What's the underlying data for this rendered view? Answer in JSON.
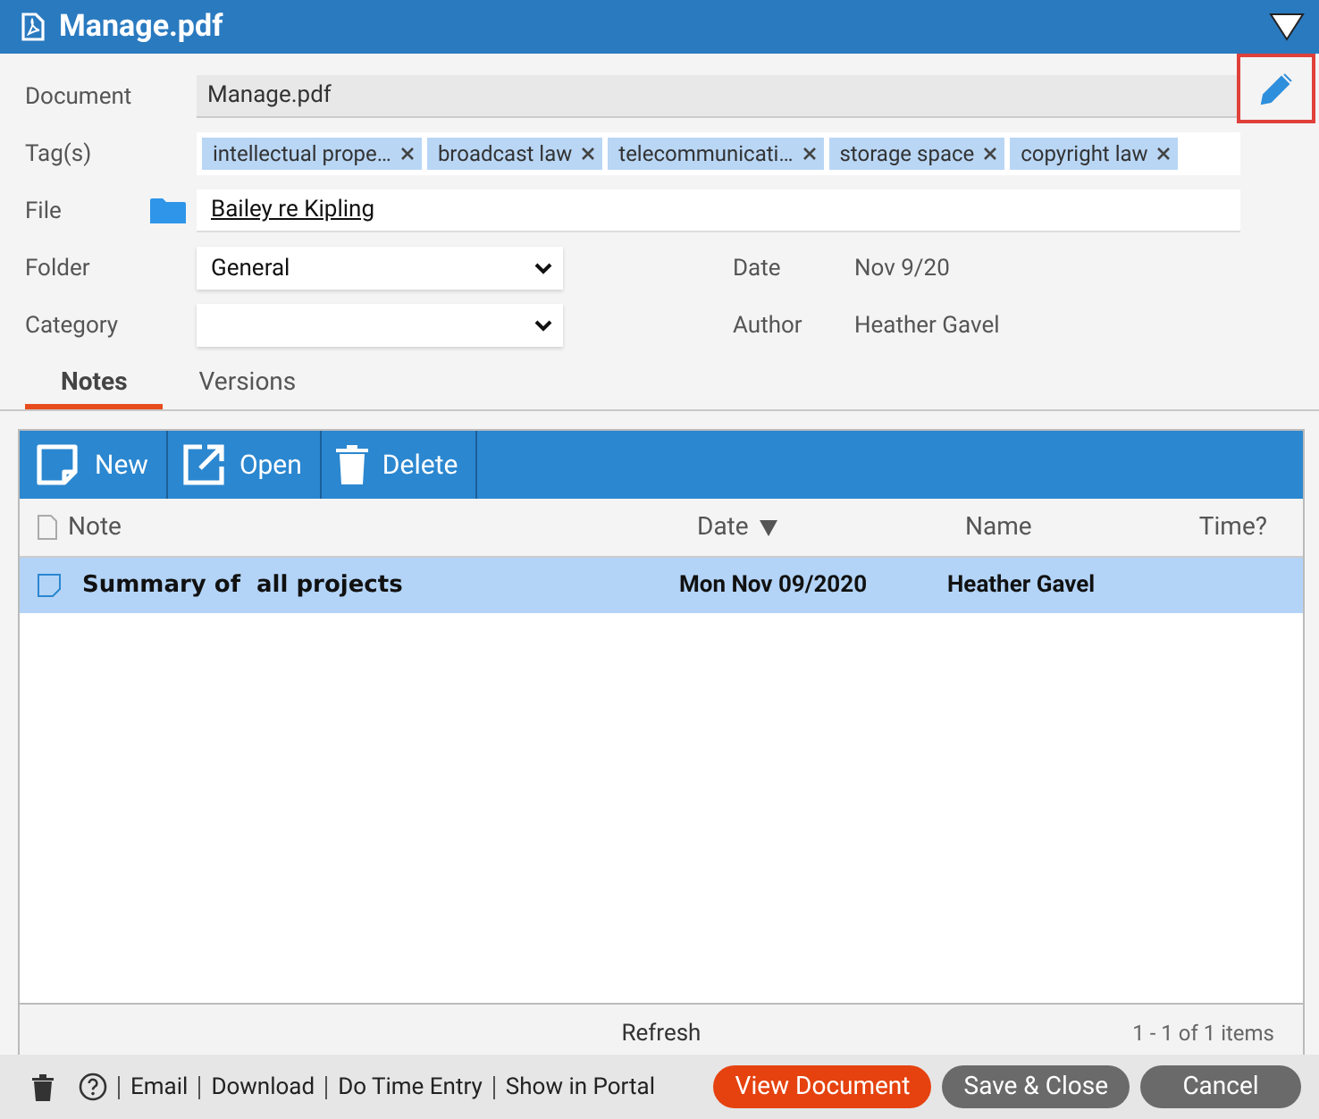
{
  "title": "Manage.pdf",
  "document": {
    "label": "Document",
    "value": "Manage.pdf"
  },
  "tags": {
    "label": "Tag(s)",
    "items": [
      {
        "label": "intellectual prope…"
      },
      {
        "label": "broadcast law"
      },
      {
        "label": "telecommunicati…"
      },
      {
        "label": "storage space"
      },
      {
        "label": "copyright law"
      }
    ]
  },
  "file": {
    "label": "File",
    "value": "Bailey re Kipling"
  },
  "folder": {
    "label": "Folder",
    "value": "General"
  },
  "category": {
    "label": "Category"
  },
  "date": {
    "label": "Date",
    "value": "Nov 9/20"
  },
  "author": {
    "label": "Author",
    "value": "Heather Gavel"
  },
  "tabs": [
    {
      "label": "Notes",
      "selected": true
    },
    {
      "label": "Versions",
      "selected": false
    }
  ],
  "toolbar": [
    {
      "label": "New",
      "kind": "new"
    },
    {
      "label": "Open",
      "kind": "open"
    },
    {
      "label": "Delete",
      "kind": "delete"
    }
  ],
  "grid": {
    "columns": [
      {
        "label": "Note",
        "sorted": false
      },
      {
        "label": "Date",
        "sorted": true
      },
      {
        "label": "Name",
        "sorted": false
      },
      {
        "label": "Time?",
        "sorted": false
      }
    ],
    "rows": [
      {
        "note": "Summary of  all projects",
        "date": "Mon Nov 09/2020",
        "name": "Heather Gavel",
        "selected": true
      }
    ],
    "refresh": "Refresh",
    "paging": "1 - 1 of 1 items"
  },
  "links": [
    "Email",
    "Download",
    "Do Time Entry",
    "Show in Portal"
  ],
  "buttons": [
    {
      "label": "View Document",
      "kind": "primary"
    },
    {
      "label": "Save & Close",
      "kind": "secondary"
    },
    {
      "label": "Cancel",
      "kind": "secondary"
    }
  ]
}
